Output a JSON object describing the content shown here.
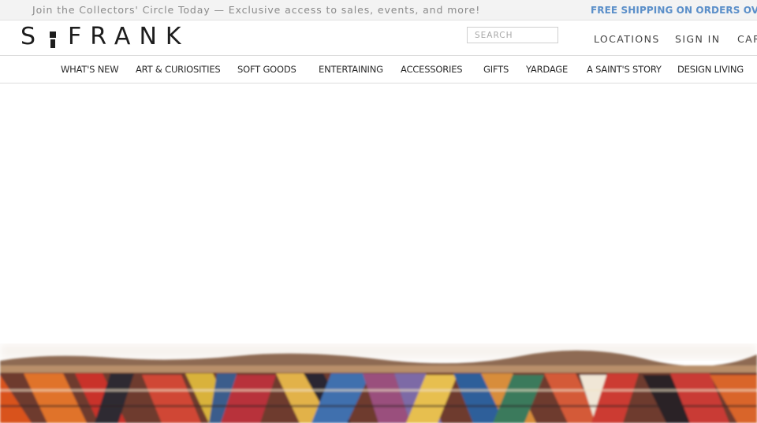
{
  "promo": {
    "message": "Join the Collectors' Circle Today — Exclusive access to sales, events, and more!",
    "shipping": "FREE SHIPPING ON ORDERS OVER $"
  },
  "header": {
    "logo": {
      "left": "S",
      "right": "FRANK"
    },
    "search": {
      "placeholder": "SEARCH",
      "value": ""
    },
    "links": {
      "locations": "LOCATIONS",
      "sign_in": "SIGN IN",
      "cart": "CAR"
    }
  },
  "nav": {
    "items": [
      {
        "label": "WHAT'S NEW"
      },
      {
        "label": "ART & CURIOSITIES"
      },
      {
        "label": "SOFT GOODS"
      },
      {
        "label": "ENTERTAINING"
      },
      {
        "label": "ACCESSORIES"
      },
      {
        "label": "GIFTS"
      },
      {
        "label": "YARDAGE"
      },
      {
        "label": "A SAINT'S STORY"
      },
      {
        "label": "DESIGN LIVING"
      }
    ]
  },
  "colors": {
    "accent_blue": "#5b8fc9",
    "promo_bg": "#f3f3f3",
    "text_dark": "#1d1d1d"
  },
  "hero": {
    "image": "woven-textile-rug-image"
  }
}
